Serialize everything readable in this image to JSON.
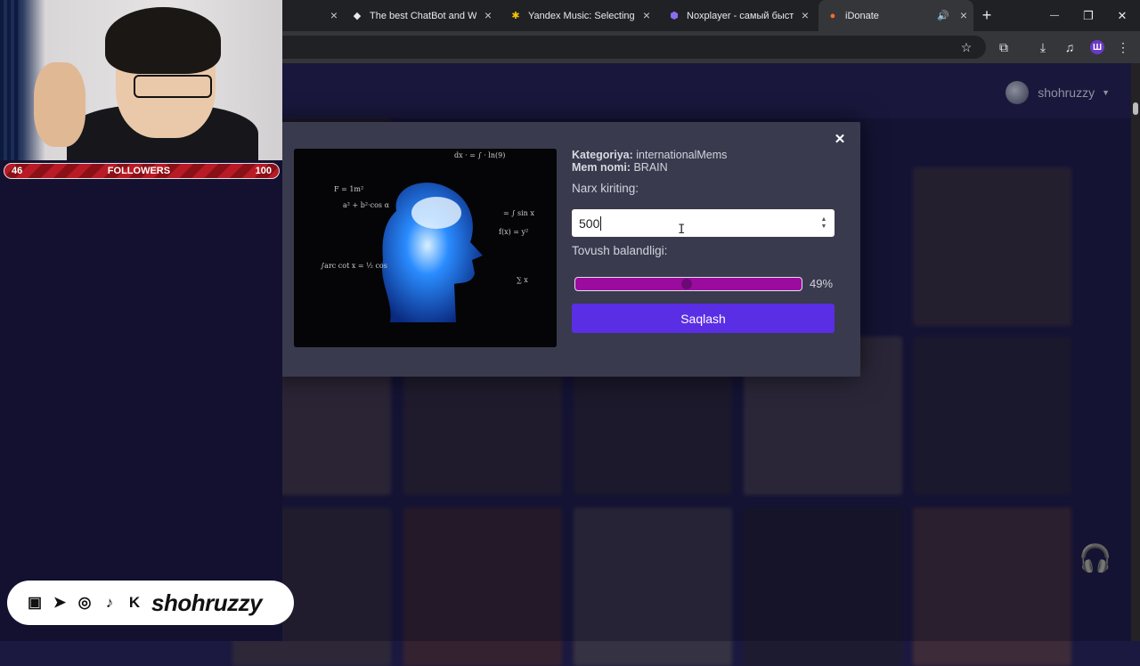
{
  "browser": {
    "tabs": [
      {
        "title": "",
        "active": false
      },
      {
        "title": "The best ChatBot and Wid",
        "active": false
      },
      {
        "title": "Yandex Music: Selecting m",
        "active": false
      },
      {
        "title": "Noxplayer - самый быстр",
        "active": false
      },
      {
        "title": "iDonate",
        "active": true
      }
    ],
    "new_tab": "+",
    "window_controls": {
      "minimize": "—",
      "maximize": "❐",
      "close": "✕"
    },
    "profile_letter": "Ш"
  },
  "site": {
    "username": "shohruzzy"
  },
  "modal": {
    "category_label": "Kategoriya:",
    "category_value": "internationalMems",
    "name_label": "Mem nomi:",
    "name_value": "BRAIN",
    "price_label": "Narx kiriting:",
    "price_value": "500",
    "volume_label": "Tovush balandligi:",
    "volume_percent": "49%",
    "volume_level": 0.49,
    "save_label": "Saqlash",
    "close_glyph": "✕"
  },
  "stream_overlay": {
    "followers_current": "46",
    "followers_label": "FOLLOWERS",
    "followers_goal": "100",
    "followers_progress": 0.46,
    "social_handle": "shohruzzy"
  },
  "colors": {
    "accent": "#5a2ee5",
    "slider": "#9b0c9e",
    "site_bg": "#1b1940",
    "modal_bg": "#3a3a4e"
  }
}
